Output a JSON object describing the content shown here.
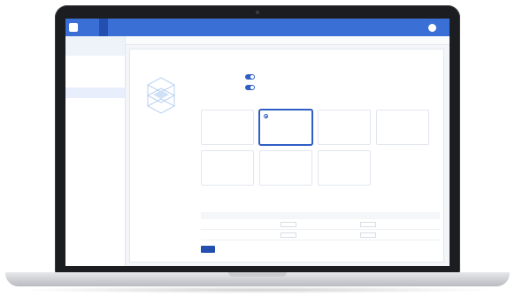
{
  "nav": {
    "items": [
      "",
      "",
      "",
      "",
      "",
      "",
      "",
      ""
    ],
    "right": [
      "",
      ""
    ]
  },
  "sidebar": {
    "title": "",
    "subtitle": "",
    "items": [
      {
        "label": ""
      },
      {
        "label": ""
      },
      {
        "label": ""
      },
      {
        "label": ""
      },
      {
        "label": ""
      },
      {
        "label": ""
      },
      {
        "label": ""
      },
      {
        "label": ""
      },
      {
        "label": ""
      },
      {
        "label": ""
      }
    ]
  },
  "main": {
    "breadcrumb": "",
    "title": "",
    "options": [
      {
        "label": "",
        "desc": ""
      },
      {
        "label": "",
        "desc": ""
      },
      {
        "label": "",
        "desc": ""
      }
    ],
    "cards": [
      {
        "title": "",
        "desc": ""
      },
      {
        "title": "",
        "desc": ""
      },
      {
        "title": "",
        "desc": ""
      },
      {
        "title": "",
        "desc": ""
      },
      {
        "title": "",
        "desc": ""
      },
      {
        "title": "",
        "desc": ""
      },
      {
        "title": "",
        "desc": ""
      }
    ],
    "table": {
      "rows": [
        {
          "label": "",
          "v1": "",
          "v2": ""
        },
        {
          "label": "",
          "v1": "",
          "v2": ""
        }
      ]
    },
    "save_label": "",
    "brand": ""
  },
  "colors": {
    "accent": "#3a6fd6",
    "accent_dark": "#2350b0"
  }
}
